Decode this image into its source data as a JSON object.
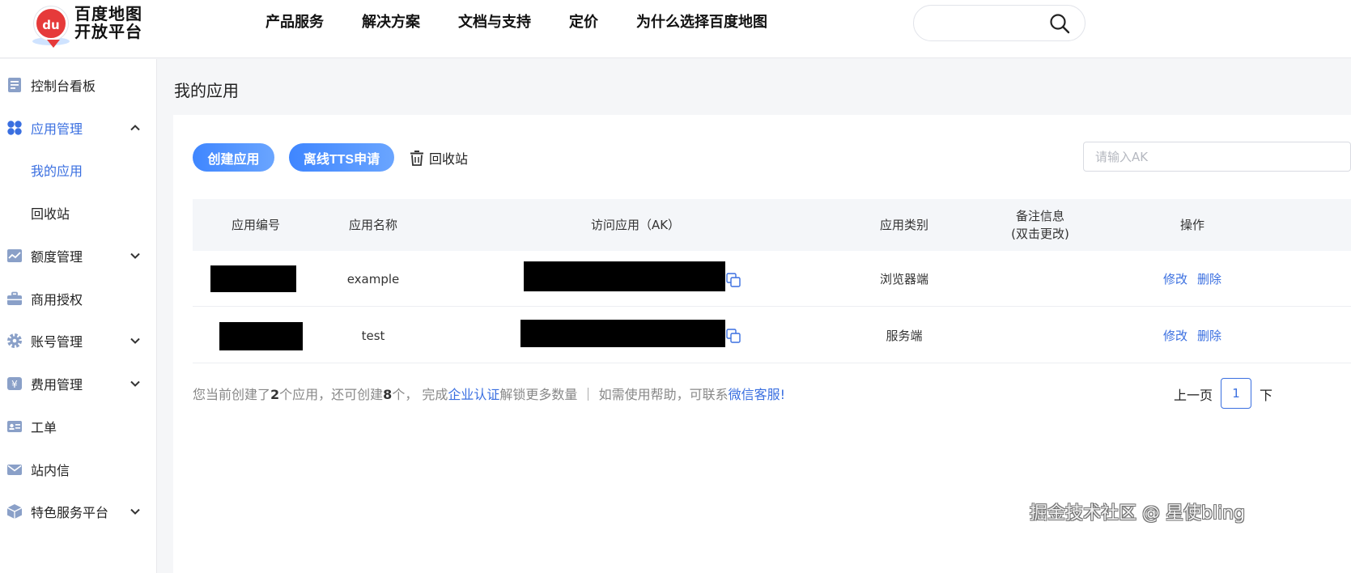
{
  "header": {
    "logo_badge": "du",
    "logo_line1": "百度地图",
    "logo_line2": "开放平台",
    "nav": [
      "产品服务",
      "解决方案",
      "文档与支持",
      "定价",
      "为什么选择百度地图"
    ],
    "search_value": ""
  },
  "sidebar": {
    "items": [
      {
        "label": "控制台看板",
        "icon": "dashboard-icon"
      },
      {
        "label": "应用管理",
        "icon": "apps-icon",
        "expanded": true
      },
      {
        "label": "我的应用",
        "sub": true,
        "active": true
      },
      {
        "label": "回收站",
        "sub": true
      },
      {
        "label": "额度管理",
        "icon": "quota-chart-icon",
        "expanded": false
      },
      {
        "label": "商用授权",
        "icon": "briefcase-icon"
      },
      {
        "label": "账号管理",
        "icon": "gear-icon",
        "expanded": false
      },
      {
        "label": "费用管理",
        "icon": "yen-icon",
        "expanded": false
      },
      {
        "label": "工单",
        "icon": "id-card-icon"
      },
      {
        "label": "站内信",
        "icon": "mail-icon"
      },
      {
        "label": "特色服务平台",
        "icon": "cube-icon",
        "expanded": false
      }
    ]
  },
  "main": {
    "title": "我的应用",
    "create_button": "创建应用",
    "tts_button": "离线TTS申请",
    "recycle_label": "回收站",
    "ak_placeholder": "请输入AK",
    "table": {
      "headers": [
        "应用编号",
        "应用名称",
        "访问应用（AK）",
        "应用类别",
        "备注信息",
        "(双击更改)",
        "操作"
      ],
      "rows": [
        {
          "name": "example",
          "type": "浏览器端",
          "edit": "修改",
          "delete": "删除"
        },
        {
          "name": "test",
          "type": "服务端",
          "edit": "修改",
          "delete": "删除"
        }
      ]
    },
    "footer": {
      "p1": "您当前创建了",
      "created": "2",
      "p2": "个应用，还可创建",
      "remaining": "8",
      "p3": "个，  完成",
      "link1": "企业认证",
      "p4": "解锁更多数量  ｜  如需使用帮助，可联系",
      "link2": "微信客服!"
    },
    "pager": {
      "prev": "上一页",
      "current": "1",
      "next": "下"
    }
  },
  "watermark": "掘金技术社区 @ 星使bling",
  "colors": {
    "accent": "#3a6fe0",
    "primary_gradient_start": "#3f86ff",
    "logo_red": "#e63a3a"
  }
}
